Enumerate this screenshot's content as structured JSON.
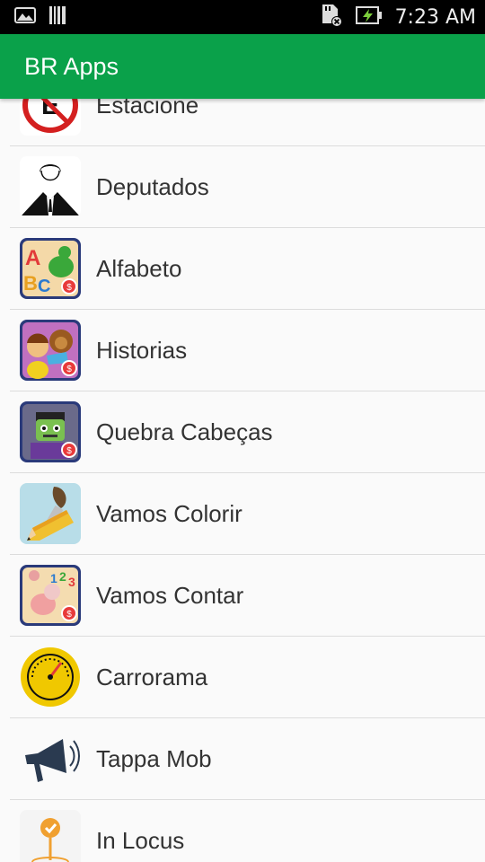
{
  "status_bar": {
    "time": "7:23 AM",
    "icons": [
      "image-notification-icon",
      "barcode-notification-icon",
      "sd-card-icon",
      "battery-charging-icon"
    ]
  },
  "app_bar": {
    "title": "BR Apps"
  },
  "colors": {
    "primary": "#0aa14a",
    "status_bar": "#000000",
    "text": "#333333",
    "divider": "#dcdcdc"
  },
  "apps": [
    {
      "label": "Estacione",
      "icon": "estacione-sign-icon"
    },
    {
      "label": "Deputados",
      "icon": "deputado-man-icon"
    },
    {
      "label": "Alfabeto",
      "icon": "alfabeto-abc-dino-icon"
    },
    {
      "label": "Historias",
      "icon": "historias-story-icon"
    },
    {
      "label": "Quebra Cabeças",
      "icon": "quebra-cabecas-monster-icon"
    },
    {
      "label": "Vamos Colorir",
      "icon": "vamos-colorir-brush-icon"
    },
    {
      "label": "Vamos Contar",
      "icon": "vamos-contar-123-icon"
    },
    {
      "label": "Carrorama",
      "icon": "carrorama-speedometer-icon"
    },
    {
      "label": "Tappa Mob",
      "icon": "tappa-mob-megaphone-icon"
    },
    {
      "label": "In Locus",
      "icon": "in-locus-pin-icon"
    }
  ]
}
